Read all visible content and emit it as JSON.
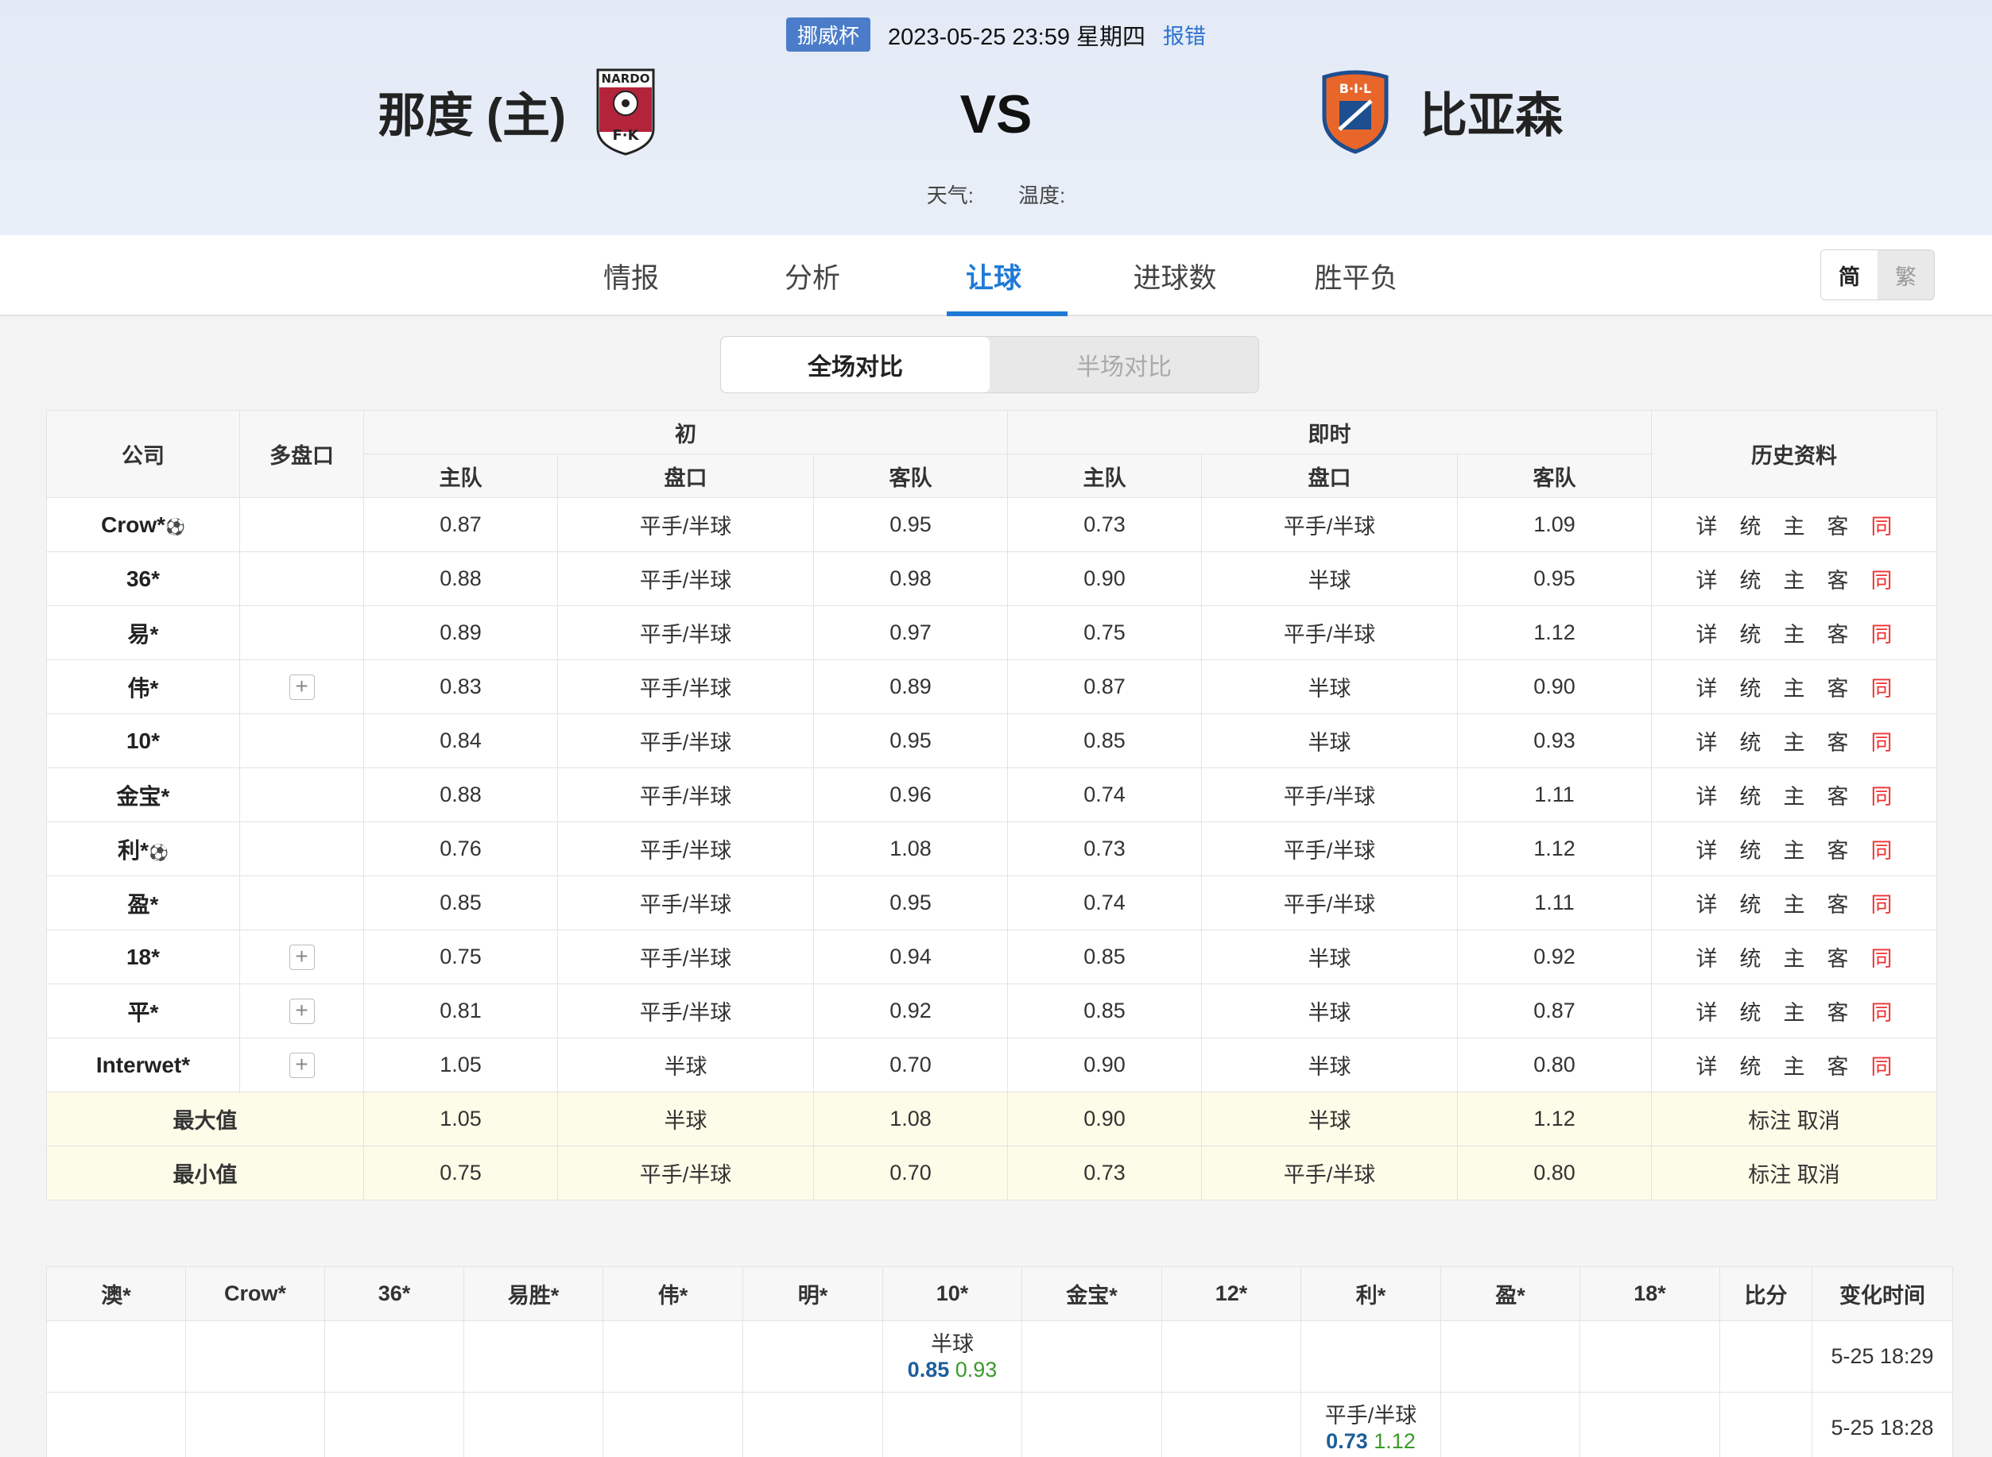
{
  "match": {
    "league": "挪威杯",
    "datetime": "2023-05-25 23:59 星期四",
    "report": "报错",
    "home": "那度 (主)",
    "away": "比亚森",
    "vs": "VS",
    "weather_label": "天气:",
    "temp_label": "温度:"
  },
  "logos": {
    "home_text_top": "NARDO",
    "home_text_bottom": "F·K",
    "away_text": "B·I·L"
  },
  "tabs": [
    "情报",
    "分析",
    "让球",
    "进球数",
    "胜平负"
  ],
  "active_tab": 2,
  "lang": {
    "simplified": "简",
    "traditional": "繁"
  },
  "segment": {
    "full": "全场对比",
    "half": "半场对比"
  },
  "odds_header": {
    "company": "公司",
    "multi": "多盘口",
    "initial": "初",
    "live": "即时",
    "history": "历史资料",
    "home": "主队",
    "line": "盘口",
    "away": "客队"
  },
  "history_links": {
    "detail": "详",
    "stats": "统",
    "home": "主",
    "away": "客",
    "same": "同"
  },
  "odds_rows": [
    {
      "company": "Crow*",
      "ball": true,
      "multi": false,
      "ih": "0.87",
      "il": "平手/半球",
      "ia": "0.95",
      "lh": "0.73",
      "ll": "平手/半球",
      "la": "1.09"
    },
    {
      "company": "36*",
      "ball": false,
      "multi": false,
      "ih": "0.88",
      "il": "平手/半球",
      "ia": "0.98",
      "lh": "0.90",
      "ll": "半球",
      "la": "0.95"
    },
    {
      "company": "易*",
      "ball": false,
      "multi": false,
      "ih": "0.89",
      "il": "平手/半球",
      "ia": "0.97",
      "lh": "0.75",
      "ll": "平手/半球",
      "la": "1.12"
    },
    {
      "company": "伟*",
      "ball": false,
      "multi": true,
      "ih": "0.83",
      "il": "平手/半球",
      "ia": "0.89",
      "lh": "0.87",
      "ll": "半球",
      "la": "0.90"
    },
    {
      "company": "10*",
      "ball": false,
      "multi": false,
      "ih": "0.84",
      "il": "平手/半球",
      "ia": "0.95",
      "lh": "0.85",
      "ll": "半球",
      "la": "0.93"
    },
    {
      "company": "金宝*",
      "ball": false,
      "multi": false,
      "ih": "0.88",
      "il": "平手/半球",
      "ia": "0.96",
      "lh": "0.74",
      "ll": "平手/半球",
      "la": "1.11"
    },
    {
      "company": "利*",
      "ball": true,
      "multi": false,
      "ih": "0.76",
      "il": "平手/半球",
      "ia": "1.08",
      "lh": "0.73",
      "ll": "平手/半球",
      "la": "1.12"
    },
    {
      "company": "盈*",
      "ball": false,
      "multi": false,
      "ih": "0.85",
      "il": "平手/半球",
      "ia": "0.95",
      "lh": "0.74",
      "ll": "平手/半球",
      "la": "1.11"
    },
    {
      "company": "18*",
      "ball": false,
      "multi": true,
      "ih": "0.75",
      "il": "平手/半球",
      "ia": "0.94",
      "lh": "0.85",
      "ll": "半球",
      "la": "0.92"
    },
    {
      "company": "平*",
      "ball": false,
      "multi": true,
      "ih": "0.81",
      "il": "平手/半球",
      "ia": "0.92",
      "lh": "0.85",
      "ll": "半球",
      "la": "0.87"
    },
    {
      "company": "Interwet*",
      "ball": false,
      "multi": true,
      "ih": "1.05",
      "il": "半球",
      "ia": "0.70",
      "lh": "0.90",
      "ll": "半球",
      "la": "0.80"
    }
  ],
  "stats_rows": [
    {
      "label": "最大值",
      "ih": "1.05",
      "il": "半球",
      "ia": "1.08",
      "lh": "0.90",
      "ll": "半球",
      "la": "1.12",
      "mark": "标注",
      "cancel": "取消"
    },
    {
      "label": "最小值",
      "ih": "0.75",
      "il": "平手/半球",
      "ia": "0.70",
      "lh": "0.73",
      "ll": "平手/半球",
      "la": "0.80",
      "mark": "标注",
      "cancel": "取消"
    }
  ],
  "change_header": [
    "澳*",
    "Crow*",
    "36*",
    "易胜*",
    "伟*",
    "明*",
    "10*",
    "金宝*",
    "12*",
    "利*",
    "盈*",
    "18*",
    "比分",
    "变化时间"
  ],
  "change_rows": [
    {
      "col": 6,
      "line": "半球",
      "h": "0.85",
      "a": "0.93",
      "time": "5-25 18:29"
    },
    {
      "col": 9,
      "line": "平手/半球",
      "h": "0.73",
      "a": "1.12",
      "time": "5-25 18:28"
    }
  ]
}
